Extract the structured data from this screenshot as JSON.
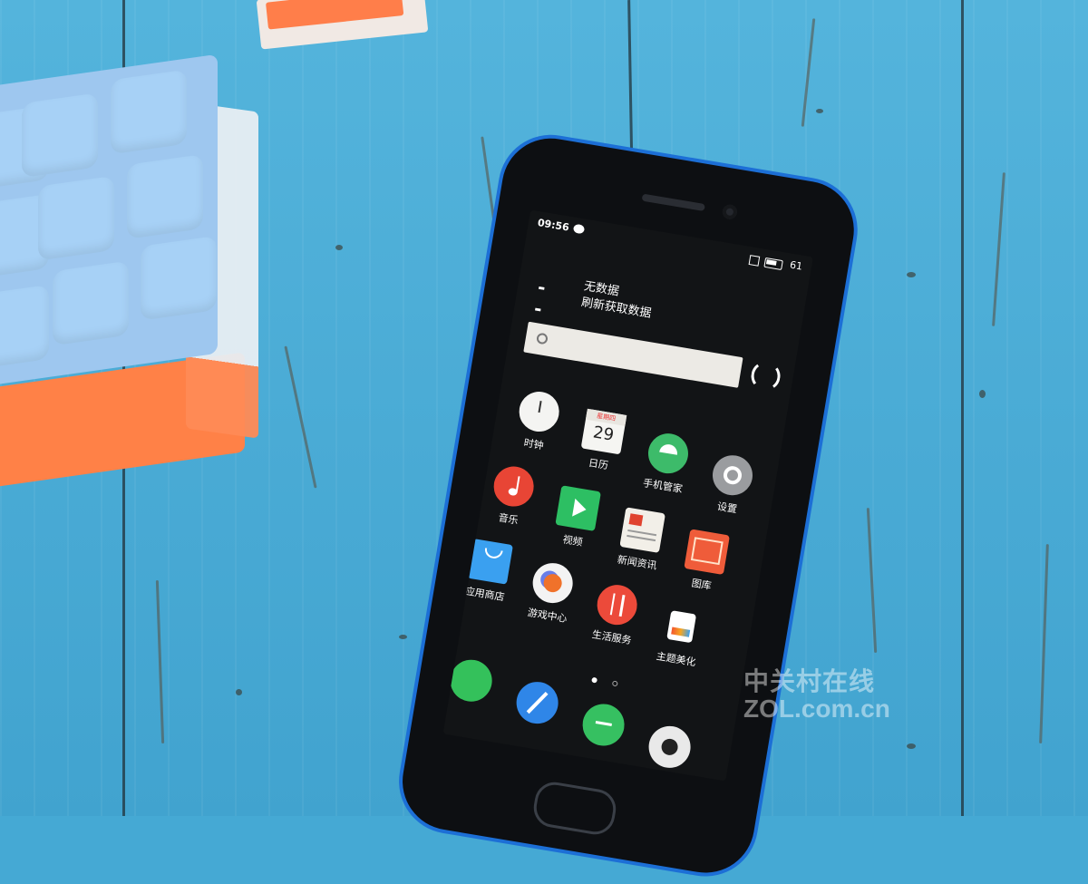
{
  "status_bar": {
    "time": "09:56",
    "battery": "61"
  },
  "weather_widget": {
    "temp": "--",
    "line1": "无数据",
    "line2": "刷新获取数据"
  },
  "apps": {
    "clock": "时钟",
    "calendar": "日历",
    "calendar_day": "29",
    "calendar_weekday": "星期四",
    "phone_manager": "手机管家",
    "settings": "设置",
    "music": "音乐",
    "video": "视频",
    "news": "新闻资讯",
    "gallery": "图库",
    "app_store": "应用商店",
    "game_center": "游戏中心",
    "life_service": "生活服务",
    "themes": "主题美化"
  },
  "watermark": {
    "line1": "中关村在线",
    "line2": "ZOL.com.cn"
  }
}
